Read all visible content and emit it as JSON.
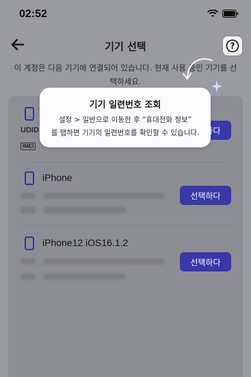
{
  "status_bar": {
    "time": "02:52"
  },
  "header": {
    "title": "기기 선택",
    "help_label": "?"
  },
  "subtitle": "이 계정은 다음 기기에 연결되어 있습니다. 현재 사용 중인 기기를 선택하세요.",
  "tooltip": {
    "title": "기기 일련번호 조회",
    "body_line1": "설정 > 일반으로 이동한 후 “휴대전화 정보”",
    "body_line2": "를 탭하면 기기의 일련번호를 확인할 수 있습니다."
  },
  "devices": [
    {
      "name": "UDID",
      "tag": "IMEI",
      "button": "선택하다"
    },
    {
      "name": "iPhone",
      "button": "선택하다"
    },
    {
      "name": "iPhone12 iOS16.1.2",
      "button": "선택하다"
    }
  ],
  "colors": {
    "accent": "#3838a8",
    "overlay": "#9a9aa2",
    "tooltip_bg": "#fbfbfd"
  }
}
